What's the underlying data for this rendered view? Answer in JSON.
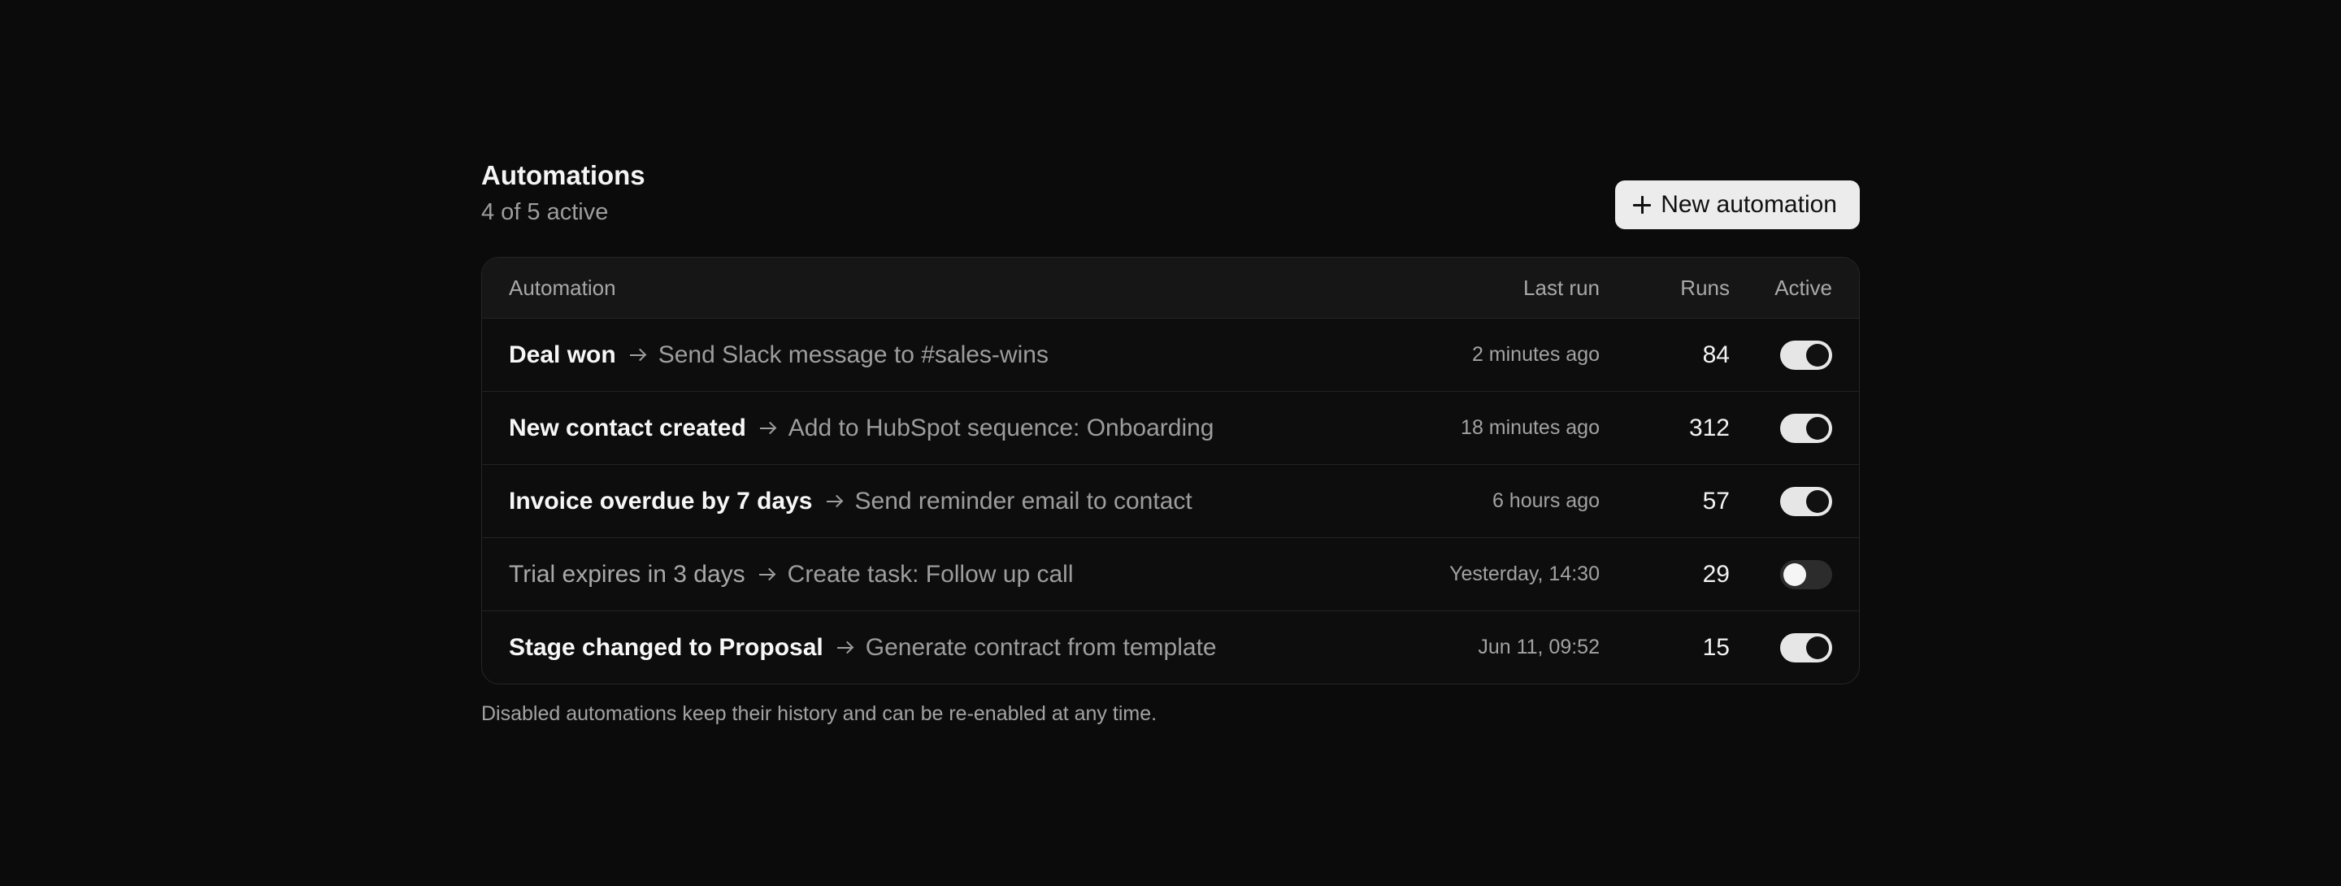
{
  "header": {
    "title": "Automations",
    "subtitle": "4 of 5 active",
    "new_button_label": "New automation"
  },
  "table": {
    "columns": {
      "automation": "Automation",
      "last_run": "Last run",
      "runs": "Runs",
      "active": "Active"
    },
    "rows": [
      {
        "trigger": "Deal won",
        "action": "Send Slack message to #sales-wins",
        "last_run": "2 minutes ago",
        "runs": "84",
        "active": true
      },
      {
        "trigger": "New contact created",
        "action": "Add to HubSpot sequence: Onboarding",
        "last_run": "18 minutes ago",
        "runs": "312",
        "active": true
      },
      {
        "trigger": "Invoice overdue by 7 days",
        "action": "Send reminder email to contact",
        "last_run": "6 hours ago",
        "runs": "57",
        "active": true
      },
      {
        "trigger": "Trial expires in 3 days",
        "action": "Create task: Follow up call",
        "last_run": "Yesterday, 14:30",
        "runs": "29",
        "active": false
      },
      {
        "trigger": "Stage changed to Proposal",
        "action": "Generate contract from template",
        "last_run": "Jun 11, 09:52",
        "runs": "15",
        "active": true
      }
    ]
  },
  "footnote": "Disabled automations keep their history and can be re-enabled at any time.",
  "icons": {
    "new_button": "plus-icon",
    "row_separator": "arrow-right-icon"
  },
  "colors": {
    "background": "#0b0b0b",
    "toggle_on": "#e6e6e6",
    "toggle_off": "#2c2c2c"
  }
}
